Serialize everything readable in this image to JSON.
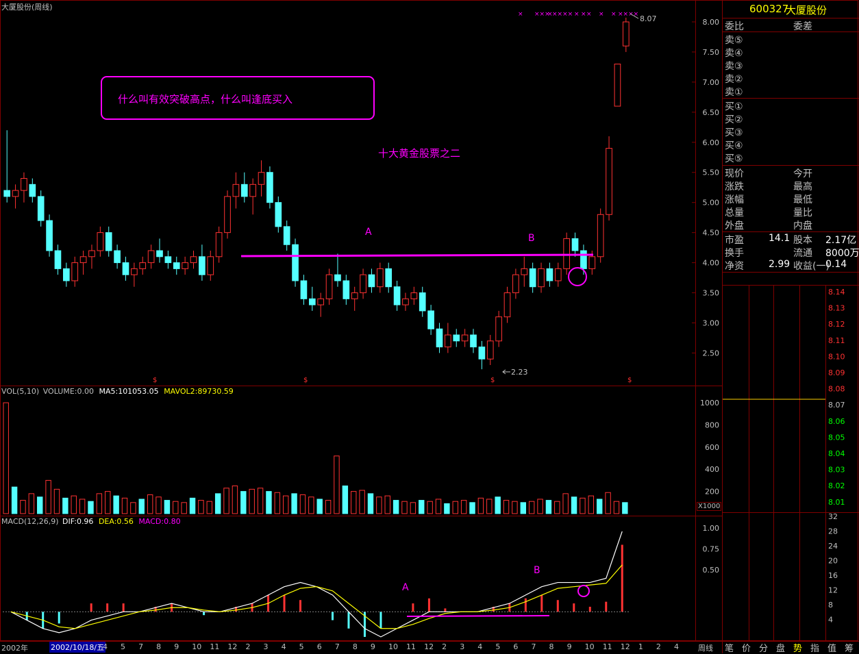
{
  "header": {
    "title": "大厦股份(周线)",
    "period_tab": "周线"
  },
  "vol_panel": {
    "label": "VOL(5,10)",
    "volume": "VOLUME:0.00",
    "ma5": "MA5:101053.05",
    "mavol2": "MAVOL2:89730.59",
    "unit": "X1000"
  },
  "macd_panel": {
    "label": "MACD(12,26,9)",
    "dif": "DIF:0.96",
    "dea": "DEA:0.56",
    "macd": "MACD:0.80"
  },
  "annotations": {
    "title_box": "什么叫有效突破高点，什么叫逢底买入",
    "subtitle": "十大黄金股票之二",
    "label_a": "A",
    "label_b": "B",
    "macd_label_a": "A",
    "macd_label_b": "B",
    "high_marker": "8.07",
    "low_marker": "2.23"
  },
  "date_axis": {
    "start_label": "2002年",
    "current_date": "2002/10/18/五",
    "ticks": [
      "8",
      "2",
      "4",
      "5",
      "7",
      "8",
      "9",
      "10",
      "11",
      "12",
      "2",
      "3",
      "4",
      "5",
      "6",
      "7",
      "8",
      "9",
      "10",
      "11",
      "12",
      "2",
      "3",
      "4",
      "5",
      "6",
      "7",
      "8",
      "9",
      "10",
      "11",
      "12",
      "1",
      "2",
      "4"
    ]
  },
  "price_axis": [
    "8.00",
    "7.50",
    "7.00",
    "6.50",
    "6.00",
    "5.50",
    "5.00",
    "4.50",
    "4.00",
    "3.50",
    "3.00",
    "2.50"
  ],
  "vol_axis": [
    "1000",
    "800",
    "600",
    "400",
    "200"
  ],
  "macd_axis": [
    "1.00",
    "0.75",
    "0.50"
  ],
  "right_panel": {
    "code": "600327",
    "name": "大厦股份",
    "order_ratio": "委比",
    "order_diff": "委差",
    "sells": [
      "卖⑤",
      "卖④",
      "卖③",
      "卖②",
      "卖①"
    ],
    "buys": [
      "买①",
      "买②",
      "买③",
      "买④",
      "买⑤"
    ],
    "stats_left": [
      "现价",
      "涨跌",
      "涨幅",
      "总量",
      "外盘"
    ],
    "stats_right": [
      "今开",
      "最高",
      "最低",
      "量比",
      "内盘"
    ],
    "fund": [
      {
        "l1": "市盈",
        "v1": "14.1",
        "l2": "股本",
        "v2": "2.17亿"
      },
      {
        "l1": "换手",
        "v1": "",
        "l2": "流通",
        "v2": "8000万"
      },
      {
        "l1": "净资",
        "v1": "2.99",
        "l2": "收益(一)",
        "v2": "0.14"
      }
    ],
    "tick_prices": [
      "8.14",
      "8.13",
      "8.12",
      "8.11",
      "8.10",
      "8.09",
      "8.08",
      "8.07",
      "8.06",
      "8.05",
      "8.04",
      "8.03",
      "8.02",
      "8.01"
    ],
    "tick_vols": [
      "32",
      "28",
      "24",
      "20",
      "16",
      "12",
      "8",
      "4"
    ],
    "tabs": [
      "笔",
      "价",
      "分",
      "盘",
      "势",
      "指",
      "值",
      "筹"
    ]
  },
  "chart_data": {
    "type": "candlestick",
    "title": "大厦股份(周线)",
    "period": "weekly",
    "price_range": [
      2.05,
      8.25
    ],
    "resistance_level": 4.1,
    "candles": [
      {
        "o": 5.2,
        "h": 6.2,
        "l": 5.0,
        "c": 5.1
      },
      {
        "o": 5.1,
        "h": 5.3,
        "l": 4.9,
        "c": 5.2
      },
      {
        "o": 5.2,
        "h": 5.5,
        "l": 5.0,
        "c": 5.4
      },
      {
        "o": 5.3,
        "h": 5.4,
        "l": 5.0,
        "c": 5.1
      },
      {
        "o": 5.1,
        "h": 5.2,
        "l": 4.6,
        "c": 4.7
      },
      {
        "o": 4.7,
        "h": 4.8,
        "l": 4.1,
        "c": 4.2
      },
      {
        "o": 4.2,
        "h": 4.3,
        "l": 3.8,
        "c": 3.9
      },
      {
        "o": 3.9,
        "h": 4.0,
        "l": 3.6,
        "c": 3.7
      },
      {
        "o": 3.7,
        "h": 4.1,
        "l": 3.6,
        "c": 4.0
      },
      {
        "o": 4.0,
        "h": 4.2,
        "l": 3.8,
        "c": 4.1
      },
      {
        "o": 4.1,
        "h": 4.3,
        "l": 3.9,
        "c": 4.2
      },
      {
        "o": 4.2,
        "h": 4.6,
        "l": 4.1,
        "c": 4.5
      },
      {
        "o": 4.5,
        "h": 4.6,
        "l": 4.1,
        "c": 4.2
      },
      {
        "o": 4.2,
        "h": 4.3,
        "l": 3.9,
        "c": 4.0
      },
      {
        "o": 4.0,
        "h": 4.1,
        "l": 3.7,
        "c": 3.8
      },
      {
        "o": 3.8,
        "h": 4.0,
        "l": 3.6,
        "c": 3.9
      },
      {
        "o": 3.9,
        "h": 4.1,
        "l": 3.8,
        "c": 4.0
      },
      {
        "o": 4.0,
        "h": 4.3,
        "l": 3.9,
        "c": 4.2
      },
      {
        "o": 4.2,
        "h": 4.4,
        "l": 4.0,
        "c": 4.1
      },
      {
        "o": 4.1,
        "h": 4.2,
        "l": 3.9,
        "c": 4.0
      },
      {
        "o": 4.0,
        "h": 4.1,
        "l": 3.8,
        "c": 3.9
      },
      {
        "o": 3.9,
        "h": 4.1,
        "l": 3.8,
        "c": 4.0
      },
      {
        "o": 4.0,
        "h": 4.2,
        "l": 3.9,
        "c": 4.1
      },
      {
        "o": 4.1,
        "h": 4.3,
        "l": 3.7,
        "c": 3.8
      },
      {
        "o": 3.8,
        "h": 4.2,
        "l": 3.7,
        "c": 4.1
      },
      {
        "o": 4.1,
        "h": 4.6,
        "l": 4.0,
        "c": 4.5
      },
      {
        "o": 4.5,
        "h": 5.2,
        "l": 4.4,
        "c": 5.1
      },
      {
        "o": 5.1,
        "h": 5.5,
        "l": 4.9,
        "c": 5.3
      },
      {
        "o": 5.3,
        "h": 5.5,
        "l": 5.0,
        "c": 5.1
      },
      {
        "o": 5.1,
        "h": 5.4,
        "l": 4.8,
        "c": 5.3
      },
      {
        "o": 5.3,
        "h": 5.7,
        "l": 5.1,
        "c": 5.5
      },
      {
        "o": 5.5,
        "h": 5.6,
        "l": 4.9,
        "c": 5.0
      },
      {
        "o": 5.0,
        "h": 5.1,
        "l": 4.5,
        "c": 4.6
      },
      {
        "o": 4.6,
        "h": 4.7,
        "l": 4.2,
        "c": 4.3
      },
      {
        "o": 4.3,
        "h": 4.4,
        "l": 3.6,
        "c": 3.7
      },
      {
        "o": 3.7,
        "h": 3.8,
        "l": 3.3,
        "c": 3.4
      },
      {
        "o": 3.4,
        "h": 3.6,
        "l": 3.2,
        "c": 3.3
      },
      {
        "o": 3.3,
        "h": 3.5,
        "l": 3.1,
        "c": 3.4
      },
      {
        "o": 3.4,
        "h": 3.9,
        "l": 3.3,
        "c": 3.8
      },
      {
        "o": 3.8,
        "h": 4.15,
        "l": 3.6,
        "c": 3.7
      },
      {
        "o": 3.7,
        "h": 3.8,
        "l": 3.3,
        "c": 3.4
      },
      {
        "o": 3.4,
        "h": 3.6,
        "l": 3.2,
        "c": 3.5
      },
      {
        "o": 3.5,
        "h": 3.9,
        "l": 3.4,
        "c": 3.8
      },
      {
        "o": 3.8,
        "h": 3.9,
        "l": 3.5,
        "c": 3.6
      },
      {
        "o": 3.6,
        "h": 4.0,
        "l": 3.5,
        "c": 3.9
      },
      {
        "o": 3.9,
        "h": 4.0,
        "l": 3.5,
        "c": 3.6
      },
      {
        "o": 3.6,
        "h": 3.7,
        "l": 3.2,
        "c": 3.3
      },
      {
        "o": 3.3,
        "h": 3.5,
        "l": 3.2,
        "c": 3.4
      },
      {
        "o": 3.4,
        "h": 3.6,
        "l": 3.3,
        "c": 3.5
      },
      {
        "o": 3.5,
        "h": 3.6,
        "l": 3.1,
        "c": 3.2
      },
      {
        "o": 3.2,
        "h": 3.3,
        "l": 2.8,
        "c": 2.9
      },
      {
        "o": 2.9,
        "h": 3.0,
        "l": 2.5,
        "c": 2.6
      },
      {
        "o": 2.6,
        "h": 3.0,
        "l": 2.5,
        "c": 2.8
      },
      {
        "o": 2.8,
        "h": 2.9,
        "l": 2.6,
        "c": 2.7
      },
      {
        "o": 2.7,
        "h": 2.9,
        "l": 2.6,
        "c": 2.8
      },
      {
        "o": 2.8,
        "h": 2.9,
        "l": 2.5,
        "c": 2.6
      },
      {
        "o": 2.6,
        "h": 2.7,
        "l": 2.23,
        "c": 2.4
      },
      {
        "o": 2.4,
        "h": 2.8,
        "l": 2.3,
        "c": 2.7
      },
      {
        "o": 2.7,
        "h": 3.2,
        "l": 2.6,
        "c": 3.1
      },
      {
        "o": 3.1,
        "h": 3.6,
        "l": 3.0,
        "c": 3.5
      },
      {
        "o": 3.5,
        "h": 3.9,
        "l": 3.4,
        "c": 3.8
      },
      {
        "o": 3.8,
        "h": 4.1,
        "l": 3.6,
        "c": 3.9
      },
      {
        "o": 3.9,
        "h": 4.0,
        "l": 3.5,
        "c": 3.6
      },
      {
        "o": 3.6,
        "h": 4.0,
        "l": 3.5,
        "c": 3.9
      },
      {
        "o": 3.9,
        "h": 4.0,
        "l": 3.6,
        "c": 3.7
      },
      {
        "o": 3.7,
        "h": 4.0,
        "l": 3.6,
        "c": 3.9
      },
      {
        "o": 3.9,
        "h": 4.5,
        "l": 3.8,
        "c": 4.4
      },
      {
        "o": 4.4,
        "h": 4.5,
        "l": 4.1,
        "c": 4.2
      },
      {
        "o": 4.2,
        "h": 4.3,
        "l": 3.8,
        "c": 3.9
      },
      {
        "o": 3.9,
        "h": 4.2,
        "l": 3.8,
        "c": 4.1
      },
      {
        "o": 4.1,
        "h": 4.9,
        "l": 4.0,
        "c": 4.8
      },
      {
        "o": 4.8,
        "h": 6.1,
        "l": 4.7,
        "c": 5.9
      },
      {
        "o": 6.6,
        "h": 7.3,
        "l": 6.6,
        "c": 7.3
      },
      {
        "o": 7.6,
        "h": 8.07,
        "l": 7.5,
        "c": 8.0
      }
    ],
    "volume_series": [
      {
        "name": "VOLUME",
        "values": [
          1000,
          240,
          120,
          180,
          150,
          300,
          220,
          140,
          160,
          130,
          110,
          180,
          200,
          160,
          140,
          100,
          130,
          170,
          150,
          120,
          110,
          100,
          140,
          120,
          110,
          180,
          230,
          250,
          200,
          220,
          230,
          200,
          190,
          160,
          180,
          170,
          150,
          130,
          120,
          520,
          250,
          200,
          210,
          180,
          150,
          160,
          120,
          110,
          100,
          120,
          110,
          130,
          90,
          110,
          120,
          100,
          140,
          130,
          150,
          120,
          110,
          100,
          110,
          130,
          120,
          110,
          180,
          150,
          140,
          160,
          130,
          190,
          110,
          100
        ]
      }
    ],
    "macd_series": [
      {
        "name": "DIF",
        "values": [
          0.0,
          -0.1,
          -0.2,
          -0.25,
          -0.2,
          -0.1,
          -0.05,
          0.0,
          0.0,
          0.05,
          0.1,
          0.05,
          0.0,
          0.0,
          0.05,
          0.1,
          0.2,
          0.3,
          0.35,
          0.3,
          0.2,
          0.0,
          -0.2,
          -0.3,
          -0.2,
          -0.1,
          0.0,
          0.0,
          0.0,
          0.0,
          0.05,
          0.1,
          0.2,
          0.3,
          0.35,
          0.35,
          0.35,
          0.4,
          0.96
        ]
      },
      {
        "name": "DEA",
        "values": [
          0.0,
          -0.05,
          -0.1,
          -0.18,
          -0.2,
          -0.15,
          -0.1,
          -0.05,
          0.0,
          0.02,
          0.05,
          0.05,
          0.02,
          0.0,
          0.02,
          0.05,
          0.1,
          0.2,
          0.28,
          0.3,
          0.25,
          0.1,
          -0.05,
          -0.2,
          -0.2,
          -0.15,
          -0.08,
          -0.02,
          0.0,
          0.0,
          0.02,
          0.05,
          0.12,
          0.2,
          0.28,
          0.3,
          0.32,
          0.34,
          0.56
        ]
      }
    ],
    "macd_range": [
      -0.3,
      1.05
    ],
    "vol_range": [
      0,
      1050
    ]
  }
}
